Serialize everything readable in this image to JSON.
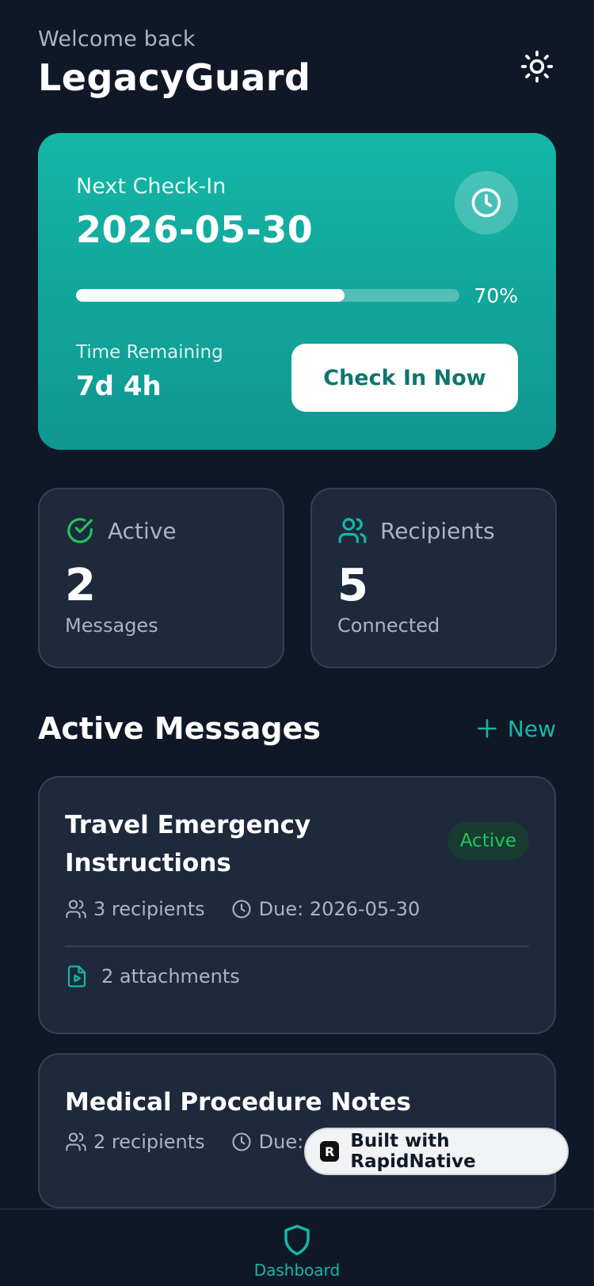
{
  "header": {
    "welcome": "Welcome back",
    "title": "LegacyGuard",
    "theme_icon": "sun-icon"
  },
  "checkin": {
    "label": "Next Check-In",
    "date": "2026-05-30",
    "progress_percent": 70,
    "progress_text": "70%",
    "remaining_label": "Time Remaining",
    "remaining_value": "7d 4h",
    "button_label": "Check In Now",
    "icon": "clock-icon"
  },
  "stats": [
    {
      "label": "Active",
      "value": "2",
      "sub": "Messages",
      "icon": "check-circle-icon",
      "icon_color": "#22c55e"
    },
    {
      "label": "Recipients",
      "value": "5",
      "sub": "Connected",
      "icon": "users-icon",
      "icon_color": "#14b8a6"
    }
  ],
  "messages_section": {
    "title": "Active Messages",
    "new_label": "New"
  },
  "messages": [
    {
      "title": "Travel Emergency Instructions",
      "status": "Active",
      "recipients": "3 recipients",
      "due": "Due: 2026-05-30",
      "attachments": "2 attachments"
    },
    {
      "title": "Medical Procedure Notes",
      "recipients": "2 recipients",
      "due": "Due: 2"
    }
  ],
  "badge": {
    "label": "Built with RapidNative",
    "logo_letter": "R"
  },
  "nav": {
    "dashboard_label": "Dashboard"
  },
  "colors": {
    "background": "#101828",
    "card": "#1e293b",
    "accent": "#14b8a6",
    "success": "#22c55e"
  }
}
